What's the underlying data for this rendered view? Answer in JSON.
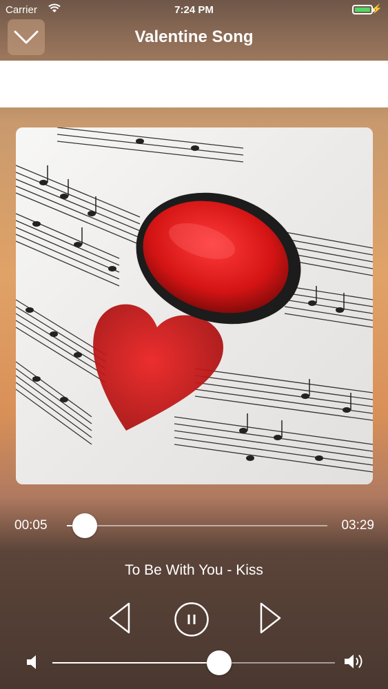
{
  "status": {
    "carrier": "Carrier",
    "time": "7:24 PM"
  },
  "nav": {
    "title": "Valentine Song",
    "back_icon": "chevron-down-icon"
  },
  "player": {
    "elapsed": "00:05",
    "duration": "03:29",
    "progress": 0.07,
    "song": "To Be With You - Kiss",
    "volume": 0.59
  },
  "colors": {
    "accent": "#ffffff",
    "battery": "#4cd964",
    "heart": "#d01818"
  }
}
